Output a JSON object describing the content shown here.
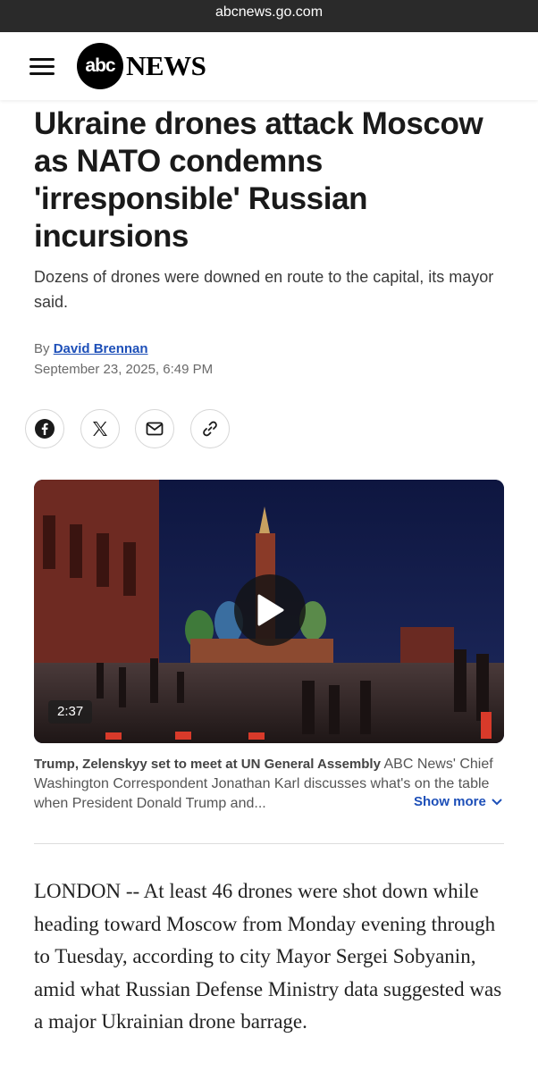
{
  "browser": {
    "url": "abcnews.go.com"
  },
  "header": {
    "logo_abc": "abc",
    "logo_news": "NEWS"
  },
  "article": {
    "headline": "Ukraine drones attack Moscow as NATO condemns 'irresponsible' Russian incursions",
    "dek": "Dozens of drones were downed en route to the capital, its mayor said.",
    "by_prefix": "By",
    "author": "David Brennan",
    "date": "September 23, 2025, 6:49 PM"
  },
  "share": {
    "icons": [
      "facebook-icon",
      "x-icon",
      "mail-icon",
      "link-icon"
    ]
  },
  "video": {
    "duration": "2:37",
    "caption_title": "Trump, Zelenskyy set to meet at UN General Assembly",
    "caption_text": "ABC News' Chief Washington Correspondent Jonathan Karl discusses what's on the table when President Donald Trump and...",
    "show_more": "Show more"
  },
  "body": {
    "paragraph1": "LONDON -- At least 46 drones were shot down while heading toward Moscow from Monday evening through to Tuesday, according to city Mayor Sergei Sobyanin, amid what Russian Defense Ministry data suggested was a major Ukrainian drone barrage."
  },
  "colors": {
    "link": "#1d4fb8",
    "urlbar": "#2a2a2a"
  }
}
